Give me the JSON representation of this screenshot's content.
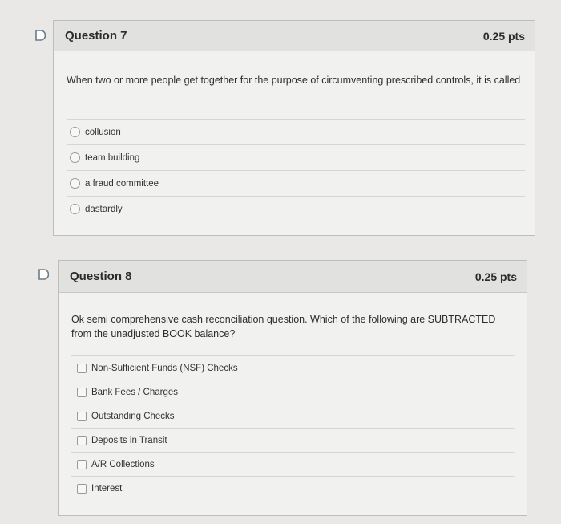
{
  "questions": [
    {
      "title": "Question 7",
      "points": "0.25 pts",
      "text": "When two or more people get together for the purpose of circumventing prescribed controls, it is called",
      "input_type": "radio",
      "answers": [
        "collusion",
        "team building",
        "a fraud committee",
        "dastardly"
      ]
    },
    {
      "title": "Question 8",
      "points": "0.25 pts",
      "text": "Ok semi comprehensive cash reconciliation question.  Which of the following are SUBTRACTED from the unadjusted BOOK balance?",
      "input_type": "checkbox",
      "answers": [
        "Non-Sufficient Funds (NSF) Checks",
        "Bank Fees / Charges",
        "Outstanding Checks",
        "Deposits in Transit",
        "A/R Collections",
        "Interest"
      ]
    }
  ],
  "icons": {
    "flag": "flag-outline-icon"
  },
  "colors": {
    "card_header": "#e1e1df",
    "card_body": "#f1f1ef",
    "page": "#e9e8e6"
  }
}
